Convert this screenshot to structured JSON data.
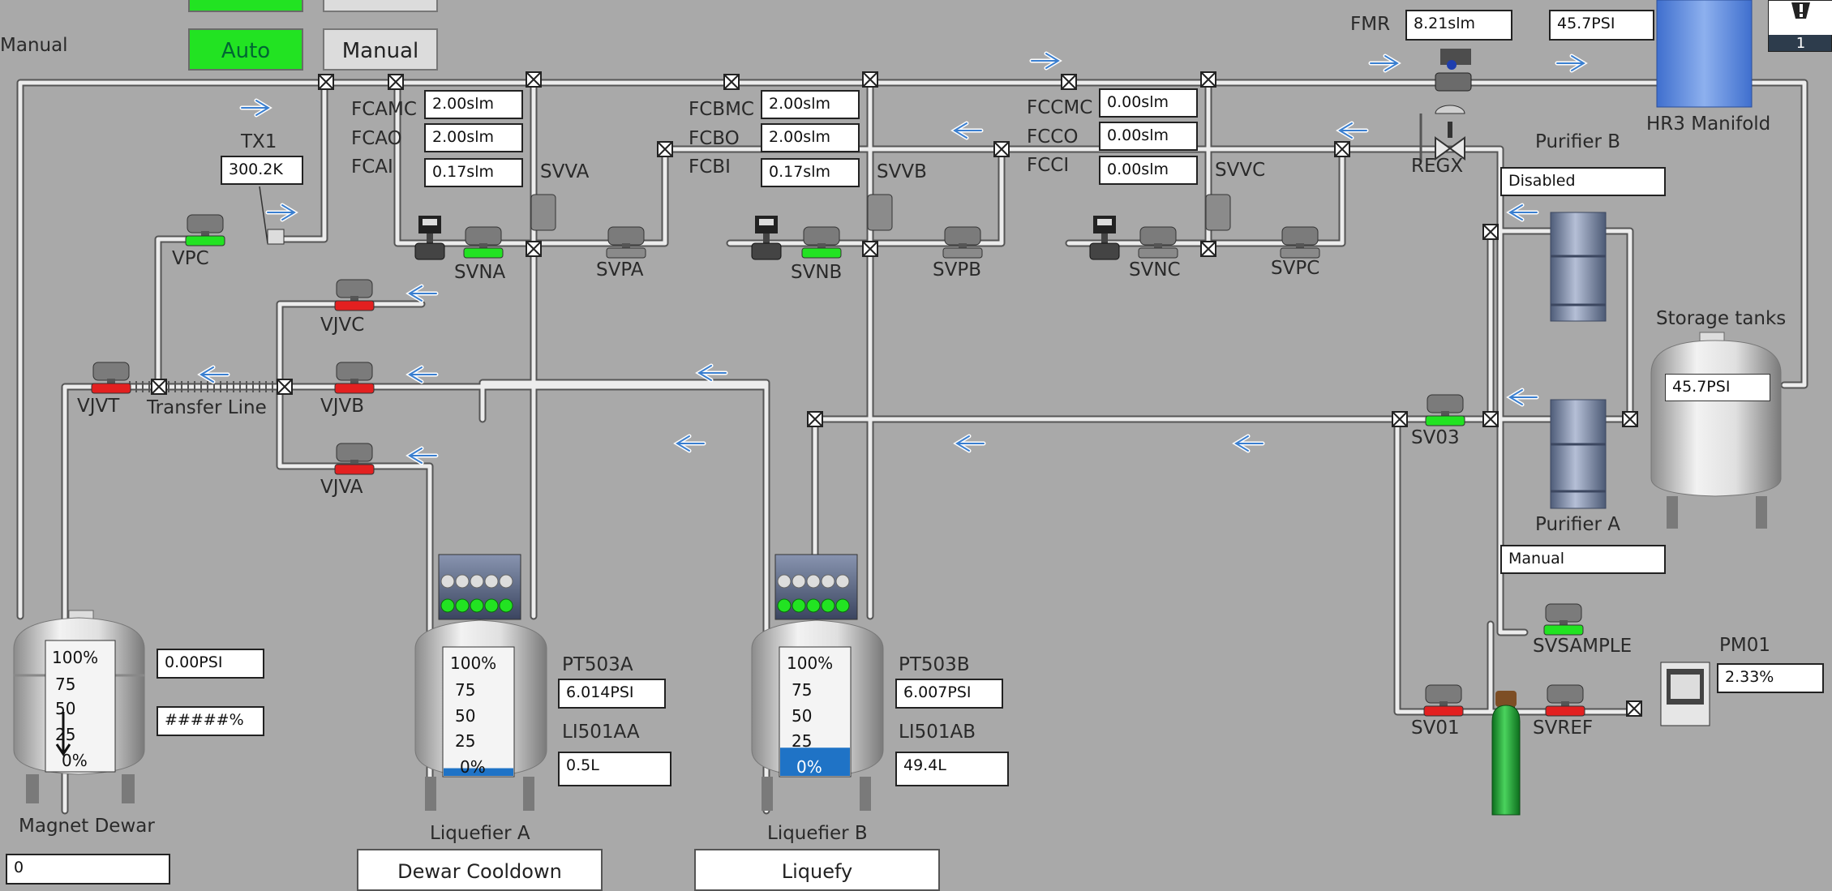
{
  "mode": {
    "label": "Manual",
    "auto_button": "Auto",
    "manual_button": "Manual"
  },
  "header_buttons": {
    "run": "",
    "stop": ""
  },
  "flow_meters": {
    "fmr": {
      "label": "FMR",
      "value": "8.21slm"
    },
    "header_pressure": "45.7PSI",
    "a": [
      {
        "label": "FCAMC",
        "value": "2.00slm"
      },
      {
        "label": "FCAO",
        "value": "2.00slm"
      },
      {
        "label": "FCAI",
        "value": "0.17slm"
      }
    ],
    "b": [
      {
        "label": "FCBMC",
        "value": "2.00slm"
      },
      {
        "label": "FCBO",
        "value": "2.00slm"
      },
      {
        "label": "FCBI",
        "value": "0.17slm"
      }
    ],
    "c": [
      {
        "label": "FCCMC",
        "value": "0.00slm"
      },
      {
        "label": "FCCO",
        "value": "0.00slm"
      },
      {
        "label": "FCCI",
        "value": "0.00slm"
      }
    ]
  },
  "manifold": {
    "label": "HR3 Manifold"
  },
  "alarm": {
    "count": "1",
    "icon": "warning-icon"
  },
  "tx1": {
    "label": "TX1",
    "value": "300.2K"
  },
  "valves": {
    "vpc": "VPC",
    "vjvt": "VJVT",
    "vjvc": "VJVC",
    "vjvb": "VJVB",
    "vjva": "VJVA",
    "svna": "SVNA",
    "svpa": "SVPA",
    "svva": "SVVA",
    "svnb": "SVNB",
    "svpb": "SVPB",
    "svvb": "SVVB",
    "svnc": "SVNC",
    "svpc": "SVPC",
    "svvc": "SVVC",
    "regx": "REGX",
    "sv03": "SV03",
    "sv01": "SV01",
    "svref": "SVREF",
    "svsample": "SVSAMPLE"
  },
  "transfer_line": "Transfer Line",
  "purifier_b": {
    "label": "Purifier B",
    "status": "Disabled"
  },
  "purifier_a": {
    "label": "Purifier A",
    "status": "Manual"
  },
  "storage": {
    "label": "Storage tanks",
    "pressure": "45.7PSI"
  },
  "pm01": {
    "label": "PM01",
    "value": "2.33%"
  },
  "magnet_dewar": {
    "label": "Magnet Dewar",
    "pressure": "0.00PSI",
    "level": "#####%",
    "input": "0",
    "gauge": [
      "100%",
      "75",
      "50",
      "25",
      "0%"
    ]
  },
  "liquefier_a": {
    "label": "Liquefier A",
    "pt_label": "PT503A",
    "pt_value": "6.014PSI",
    "li_label": "LI501AA",
    "li_value": "0.5L",
    "gauge": [
      "100%",
      "75",
      "50",
      "25",
      "0%"
    ],
    "level_fraction": 0.06,
    "button": "Dewar Cooldown"
  },
  "liquefier_b": {
    "label": "Liquefier B",
    "pt_label": "PT503B",
    "pt_value": "6.007PSI",
    "li_label": "LI501AB",
    "li_value": "49.4L",
    "gauge": [
      "100%",
      "75",
      "50",
      "25",
      "0%"
    ],
    "level_fraction": 0.22,
    "button": "Liquefy"
  },
  "colors": {
    "background": "#a9a9a9",
    "valve_open": "#22e322",
    "valve_closed": "#e32020",
    "level_fill": "#1f73c6",
    "pipe": "#e6e6e6",
    "manifold": "#4f7fd8",
    "cylinder": "#1b9a2c"
  }
}
